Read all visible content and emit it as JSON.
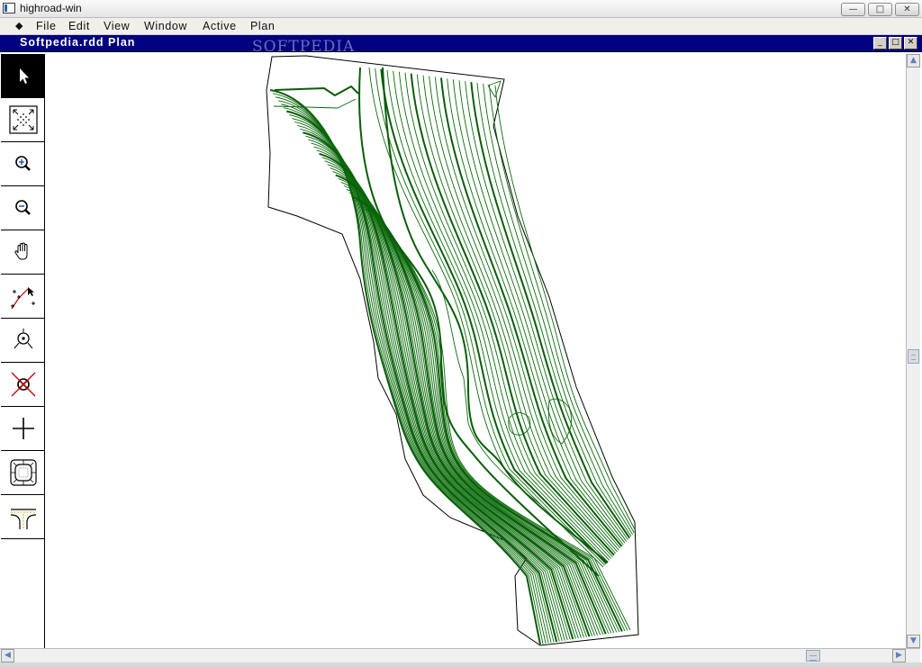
{
  "window": {
    "title": "highroad-win",
    "controls": {
      "minimize": "—",
      "maximize": "□",
      "close": "✕"
    }
  },
  "menubar": {
    "system_glyph": "◆",
    "items": [
      "File",
      "Edit",
      "View",
      "Window",
      "Active",
      "Plan"
    ]
  },
  "document": {
    "title": "Softpedia.rdd Plan",
    "controls": {
      "minimize": "_",
      "maximize": "□",
      "close": "✕"
    },
    "watermark": "SOFTPEDIA"
  },
  "toolbar": {
    "tools": [
      {
        "name": "select-tool",
        "icon": "arrow-pointer-icon",
        "active": true
      },
      {
        "name": "zoom-extents-tool",
        "icon": "zoom-extents-icon",
        "active": false
      },
      {
        "name": "zoom-in-tool",
        "icon": "magnifier-plus-icon",
        "active": false
      },
      {
        "name": "zoom-out-tool",
        "icon": "magnifier-minus-icon",
        "active": false
      },
      {
        "name": "pan-tool",
        "icon": "hand-icon",
        "active": false
      },
      {
        "name": "alignment-tool",
        "icon": "alignment-points-icon",
        "active": false
      },
      {
        "name": "point-tool",
        "icon": "target-point-icon",
        "active": false
      },
      {
        "name": "delete-point-tool",
        "icon": "delete-point-icon",
        "active": false
      },
      {
        "name": "crosshair-tool",
        "icon": "crosshair-icon",
        "active": false
      },
      {
        "name": "roundabout-tool",
        "icon": "roundabout-icon",
        "active": false
      },
      {
        "name": "junction-tool",
        "icon": "junction-icon",
        "active": false
      }
    ]
  },
  "colors": {
    "contour": "#0b6b0b",
    "contour_major": "#0a5d0a",
    "doc_titlebar": "#000080",
    "outline": "#000000"
  }
}
